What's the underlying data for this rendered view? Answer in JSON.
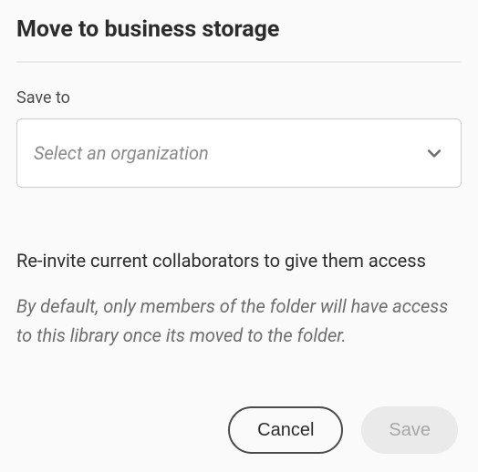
{
  "dialog": {
    "title": "Move to business storage"
  },
  "saveTo": {
    "label": "Save to",
    "placeholder": "Select an organization"
  },
  "reinvite": {
    "heading": "Re-invite current collaborators to give them access",
    "description": "By default, only members of the folder will have access to this library once its moved to the folder."
  },
  "buttons": {
    "cancel": "Cancel",
    "save": "Save"
  }
}
